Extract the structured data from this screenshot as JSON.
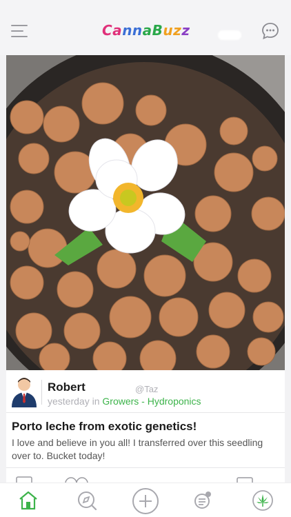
{
  "header": {
    "logo_text": "CannaBuzz",
    "icons": [
      "menu-icon",
      "chat-bubble-icon"
    ],
    "colors": {
      "green": "#3cb34a"
    }
  },
  "post": {
    "author": {
      "name": "Robert",
      "handle": "@Taz",
      "time": "yesterday",
      "in_word": " in ",
      "category": "Growers - Hydroponics"
    },
    "title": "Porto leche from exotic genetics!",
    "body": "I love and believe in you all! I transferred over this seedling over to. Bucket today!"
  },
  "tabbar": {
    "items": [
      "home-icon",
      "explore-compass-icon",
      "add-plus-icon",
      "notes-icon",
      "cannabis-leaf-icon"
    ],
    "active": "home-icon"
  }
}
